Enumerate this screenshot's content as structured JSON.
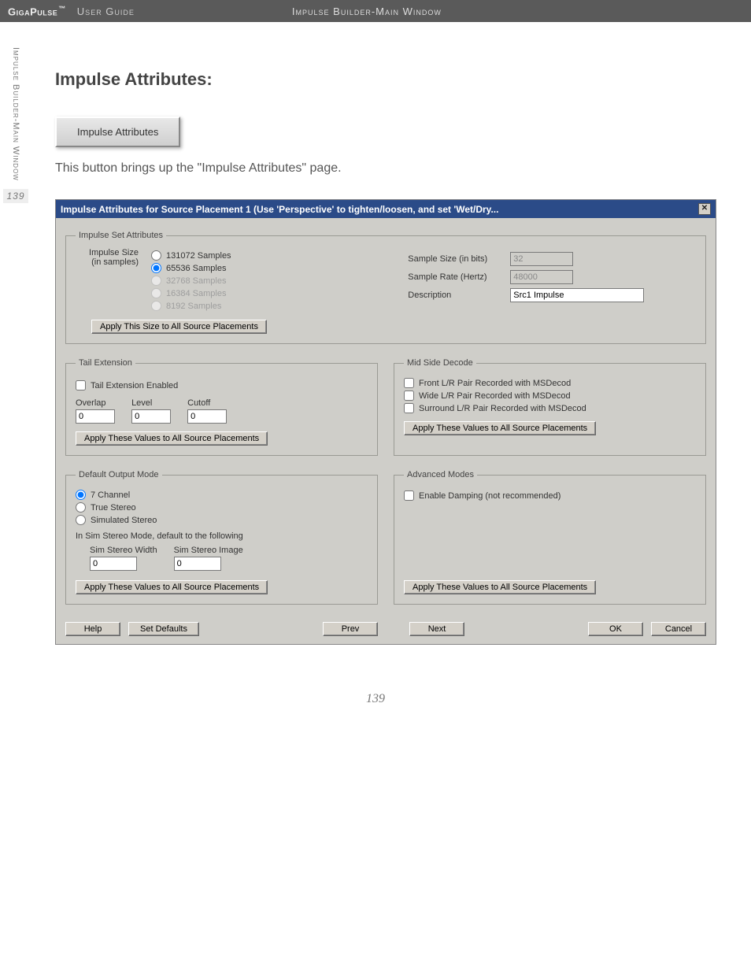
{
  "topbar": {
    "brand": "GigaPulse",
    "tm": "™",
    "guide": "User Guide",
    "section": "Impulse Builder-Main Window"
  },
  "left_rail": {
    "vertical_text": "Impulse Builder-Main Window",
    "side_page": "139"
  },
  "doc": {
    "heading": "Impulse Attributes:",
    "button_label": "Impulse Attributes",
    "intro": "This button brings up the \"Impulse Attributes\" page."
  },
  "dialog": {
    "title": "Impulse Attributes for Source Placement 1 (Use 'Perspective' to tighten/loosen, and set 'Wet/Dry...",
    "close": "✕",
    "set_attrs": {
      "legend": "Impulse Set Attributes",
      "size_label_line1": "Impulse Size",
      "size_label_line2": "(in samples)",
      "sizes": {
        "s131072": "131072 Samples",
        "s65536": "65536 Samples",
        "s32768": "32768 Samples",
        "s16384": "16384 Samples",
        "s8192": "8192 Samples"
      },
      "apply_size": "Apply This Size to All Source Placements",
      "sample_size_label": "Sample Size (in bits)",
      "sample_size_value": "32",
      "sample_rate_label": "Sample Rate (Hertz)",
      "sample_rate_value": "48000",
      "description_label": "Description",
      "description_value": "Src1 Impulse"
    },
    "tail": {
      "legend": "Tail Extension",
      "enabled_label": "Tail Extension Enabled",
      "overlap_label": "Overlap",
      "level_label": "Level",
      "cutoff_label": "Cutoff",
      "overlap": "0",
      "level": "0",
      "cutoff": "0",
      "apply": "Apply These Values to All Source Placements"
    },
    "mid_side": {
      "legend": "Mid Side Decode",
      "front": "Front L/R Pair Recorded with MSDecod",
      "wide": "Wide L/R Pair Recorded with MSDecod",
      "surround": "Surround L/R Pair Recorded with MSDecod",
      "apply": "Apply These Values to All Source Placements"
    },
    "output_mode": {
      "legend": "Default Output Mode",
      "ch7": "7 Channel",
      "true_stereo": "True Stereo",
      "sim_stereo": "Simulated Stereo",
      "note": "In Sim Stereo Mode, default to the following",
      "sim_width_label": "Sim Stereo Width",
      "sim_image_label": "Sim Stereo Image",
      "sim_width": "0",
      "sim_image": "0",
      "apply": "Apply These Values to All Source Placements"
    },
    "advanced": {
      "legend": "Advanced Modes",
      "damping": "Enable Damping (not recommended)",
      "apply": "Apply These Values to All Source Placements"
    },
    "footer": {
      "help": "Help",
      "defaults": "Set Defaults",
      "prev": "Prev",
      "next": "Next",
      "ok": "OK",
      "cancel": "Cancel"
    }
  },
  "page_number": "139"
}
